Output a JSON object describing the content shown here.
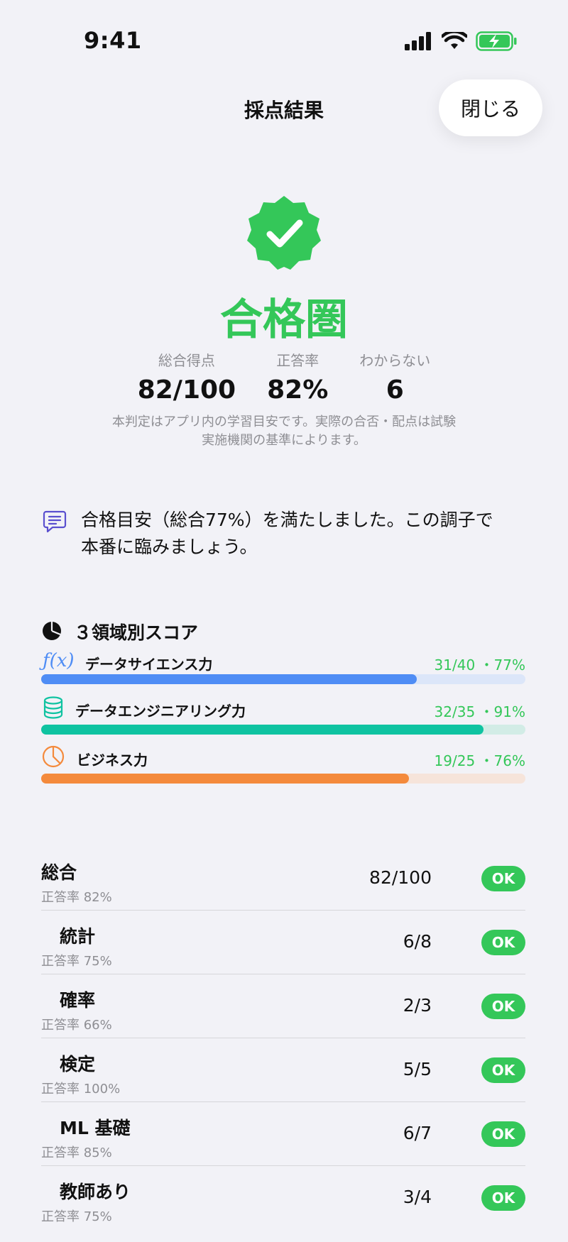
{
  "status_bar": {
    "time": "9:41"
  },
  "header": {
    "title": "採点結果",
    "close_label": "閉じる"
  },
  "result": {
    "verdict": "合格圏",
    "stats": [
      {
        "label": "総合得点",
        "value": "82/100"
      },
      {
        "label": "正答率",
        "value": "82%"
      },
      {
        "label": "わからない",
        "value": "6"
      }
    ],
    "disclaimer_line1": "本判定はアプリ内の学習目安です。実際の合否・配点は試験",
    "disclaimer_line2": "実施機関の基準によります。"
  },
  "message": {
    "line1": "合格目安（総合77%）を満たしました。この調子で",
    "line2": "本番に臨みましょう。"
  },
  "domains": {
    "title": "３領域別スコア",
    "items": [
      {
        "name": "データサイエンス力",
        "score": "31/40 ・77%",
        "fraction": 0.775,
        "color": "#4f8df5",
        "track": "#dce6f9",
        "icon": "function-icon"
      },
      {
        "name": "データエンジニアリング力",
        "score": "32/35 ・91%",
        "fraction": 0.914,
        "color": "#0fc3a1",
        "track": "#d2ece6",
        "icon": "database-icon"
      },
      {
        "name": "ビジネス力",
        "score": "19/25 ・76%",
        "fraction": 0.76,
        "color": "#f48a3c",
        "track": "#f6e4da",
        "icon": "pie-chart-icon"
      }
    ]
  },
  "rows": [
    {
      "name": "総合",
      "sub": "正答率 82%",
      "score": "82/100",
      "badge": "OK"
    },
    {
      "name": "統計",
      "sub": "正答率 75%",
      "score": "6/8",
      "badge": "OK"
    },
    {
      "name": "確率",
      "sub": "正答率 66%",
      "score": "2/3",
      "badge": "OK"
    },
    {
      "name": "検定",
      "sub": "正答率 100%",
      "score": "5/5",
      "badge": "OK"
    },
    {
      "name": "ML 基礎",
      "sub": "正答率 85%",
      "score": "6/7",
      "badge": "OK"
    },
    {
      "name": "教師あり",
      "sub": "正答率 75%",
      "score": "3/4",
      "badge": "OK"
    }
  ],
  "colors": {
    "accent_green": "#34c759",
    "background": "#f2f2f7"
  }
}
